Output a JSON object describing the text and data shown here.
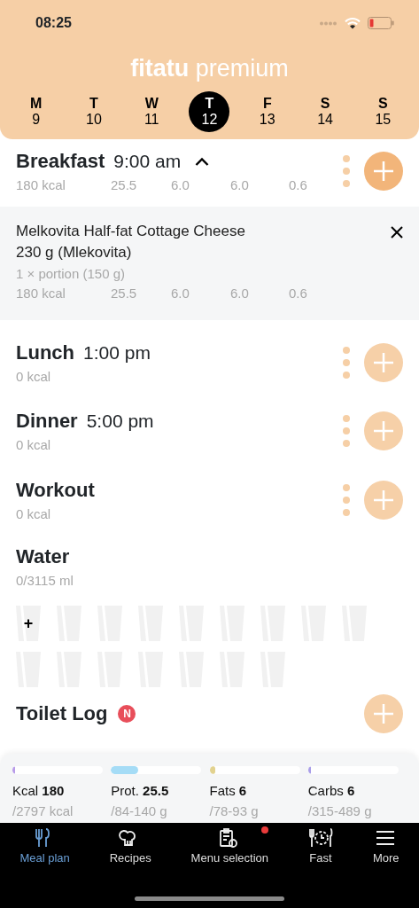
{
  "status_bar": {
    "time": "08:25"
  },
  "logo": "**fitatu** premium",
  "days": [
    {
      "letter": "M",
      "number": "9",
      "selected": false
    },
    {
      "letter": "T",
      "number": "10",
      "selected": false
    },
    {
      "letter": "W",
      "number": "11",
      "selected": false
    },
    {
      "letter": "T",
      "number": "12",
      "selected": true
    },
    {
      "letter": "F",
      "number": "13",
      "selected": false
    },
    {
      "letter": "S",
      "number": "14",
      "selected": false
    },
    {
      "letter": "S",
      "number": "15",
      "selected": false
    }
  ],
  "meals": [
    {
      "name": "Breakfast",
      "time": "9:00 am",
      "expanded": true,
      "has_items": true,
      "kcal": "180 kcal",
      "macros": [
        "25.5",
        "6.0",
        "6.0",
        "0.6"
      ],
      "items": [
        {
          "name": "Melkovita Half-fat Cottage Cheese 230 g (Mlekovita)",
          "portion": "1 × portion (150 g)",
          "kcal": "180 kcal",
          "macros": [
            "25.5",
            "6.0",
            "6.0",
            "0.6"
          ]
        }
      ]
    },
    {
      "name": "Lunch",
      "time": "1:00 pm",
      "expanded": false,
      "has_items": false,
      "kcal": "0 kcal"
    },
    {
      "name": "Dinner",
      "time": "5:00 pm",
      "expanded": false,
      "has_items": false,
      "kcal": "0 kcal"
    },
    {
      "name": "Workout",
      "expanded": false,
      "has_items": false,
      "kcal": "0 kcal"
    }
  ],
  "water": {
    "title": "Water",
    "amount": "0/3115 ml",
    "add_symbol": "+",
    "glasses": [
      {
        "filled": false
      },
      {
        "filled": false
      },
      {
        "filled": false
      },
      {
        "filled": false
      },
      {
        "filled": false
      },
      {
        "filled": false
      },
      {
        "filled": false
      },
      {
        "filled": false
      },
      {
        "filled": false
      },
      {
        "filled": false
      },
      {
        "filled": false
      },
      {
        "filled": false
      },
      {
        "filled": false
      },
      {
        "filled": false
      },
      {
        "filled": false
      },
      {
        "filled": false
      }
    ]
  },
  "toilet_log": {
    "title": "Toilet Log",
    "badge": "N"
  },
  "summary": [
    {
      "label": "Kcal",
      "value": "180",
      "target": "/2797 kcal",
      "level": 0.03,
      "color": "#b89be9"
    },
    {
      "label": "Prot.",
      "value": "25.5",
      "target": "/84-140 g",
      "level": 0.3,
      "color": "#a5dcf6"
    },
    {
      "label": "Fats",
      "value": "6",
      "target": "/78-93 g",
      "level": 0.06,
      "color": "#e2d28f"
    },
    {
      "label": "Carbs",
      "value": "6",
      "target": "/315-489 g",
      "level": 0.01,
      "color": "#a99de9"
    }
  ],
  "nav": [
    {
      "kind": "fork",
      "label": "Meal plan",
      "selected": true,
      "dot": false
    },
    {
      "kind": "chef",
      "label": "Recipes",
      "selected": false,
      "dot": false
    },
    {
      "kind": "clipboard",
      "label": "Menu selection",
      "selected": false,
      "dot": true
    },
    {
      "kind": "fast",
      "label": "Fast",
      "selected": false,
      "dot": false
    },
    {
      "kind": "menu",
      "label": "More",
      "selected": false,
      "dot": false
    }
  ]
}
